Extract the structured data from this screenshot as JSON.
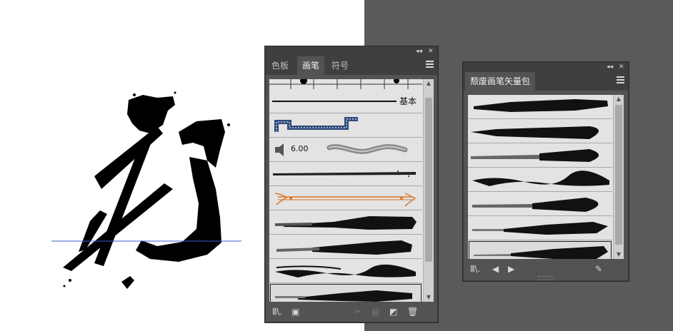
{
  "canvas": {
    "artboard_color": "#ffffff",
    "pasteboard_color": "#5a5a5a",
    "guide_color": "#3a5fcd"
  },
  "brushes_panel": {
    "tabs": [
      {
        "label": "色板",
        "active": false
      },
      {
        "label": "画笔",
        "active": true
      },
      {
        "label": "符号",
        "active": false
      }
    ],
    "basic_label": "基本",
    "calligraphic_size": "6.00",
    "collapse_icon": "double-left-arrow-icon",
    "close_icon": "close-icon",
    "menu_icon": "hamburger-menu-icon",
    "selected_row": 8,
    "footer_icons": [
      "brush-libraries-icon",
      "brush-library-options-icon",
      "remove-stroke-icon",
      "brush-options-icon",
      "new-brush-icon",
      "delete-brush-icon"
    ],
    "accent_color": "#d9772a"
  },
  "library_panel": {
    "title": "颓废画笔矢量包",
    "selected_row": 6,
    "footer_icons": [
      "library-menu-icon",
      "previous-library-icon",
      "next-library-icon",
      "add-to-brushes-icon"
    ]
  }
}
